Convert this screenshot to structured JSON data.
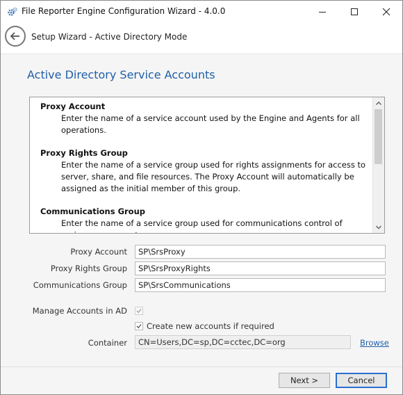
{
  "window": {
    "title": "File Reporter Engine Configuration Wizard - 4.0.0"
  },
  "header": {
    "title": "Setup Wizard - Active Directory Mode"
  },
  "main": {
    "section_title": "Active Directory Service Accounts",
    "descriptions": [
      {
        "heading": "Proxy Account",
        "body": "Enter the name of a service account used by the Engine and Agents for all operations."
      },
      {
        "heading": "Proxy Rights Group",
        "body": "Enter the name of a service group used for rights assignments for access to server, share, and file resources.  The Proxy Account will automatically be assigned as the initial member of this group."
      },
      {
        "heading": "Communications Group",
        "body": "Enter the name of a service group used for communications control of various components."
      }
    ],
    "fields": {
      "proxy_account": {
        "label": "Proxy Account",
        "value": "SP\\SrsProxy"
      },
      "proxy_rights_group": {
        "label": "Proxy Rights Group",
        "value": "SP\\SrsProxyRights"
      },
      "communications_group": {
        "label": "Communications Group",
        "value": "SP\\SrsCommunications"
      }
    },
    "manage_accounts": {
      "label": "Manage Accounts in AD",
      "checked": true,
      "enabled": false
    },
    "create_accounts": {
      "label": "Create new accounts if required",
      "checked": true
    },
    "container": {
      "label": "Container",
      "value": "CN=Users,DC=sp,DC=cctec,DC=org",
      "enabled": false
    },
    "browse_label": "Browse"
  },
  "footer": {
    "next_label": "Next >",
    "cancel_label": "Cancel"
  },
  "colors": {
    "accent": "#1f5fa8",
    "default_button_border": "#2a6fd0",
    "content_background": "#f5f5f5"
  },
  "icons": {
    "app": "gears-icon",
    "back": "back-arrow-icon",
    "minimize": "minimize-icon",
    "maximize": "maximize-icon",
    "close": "close-icon"
  }
}
